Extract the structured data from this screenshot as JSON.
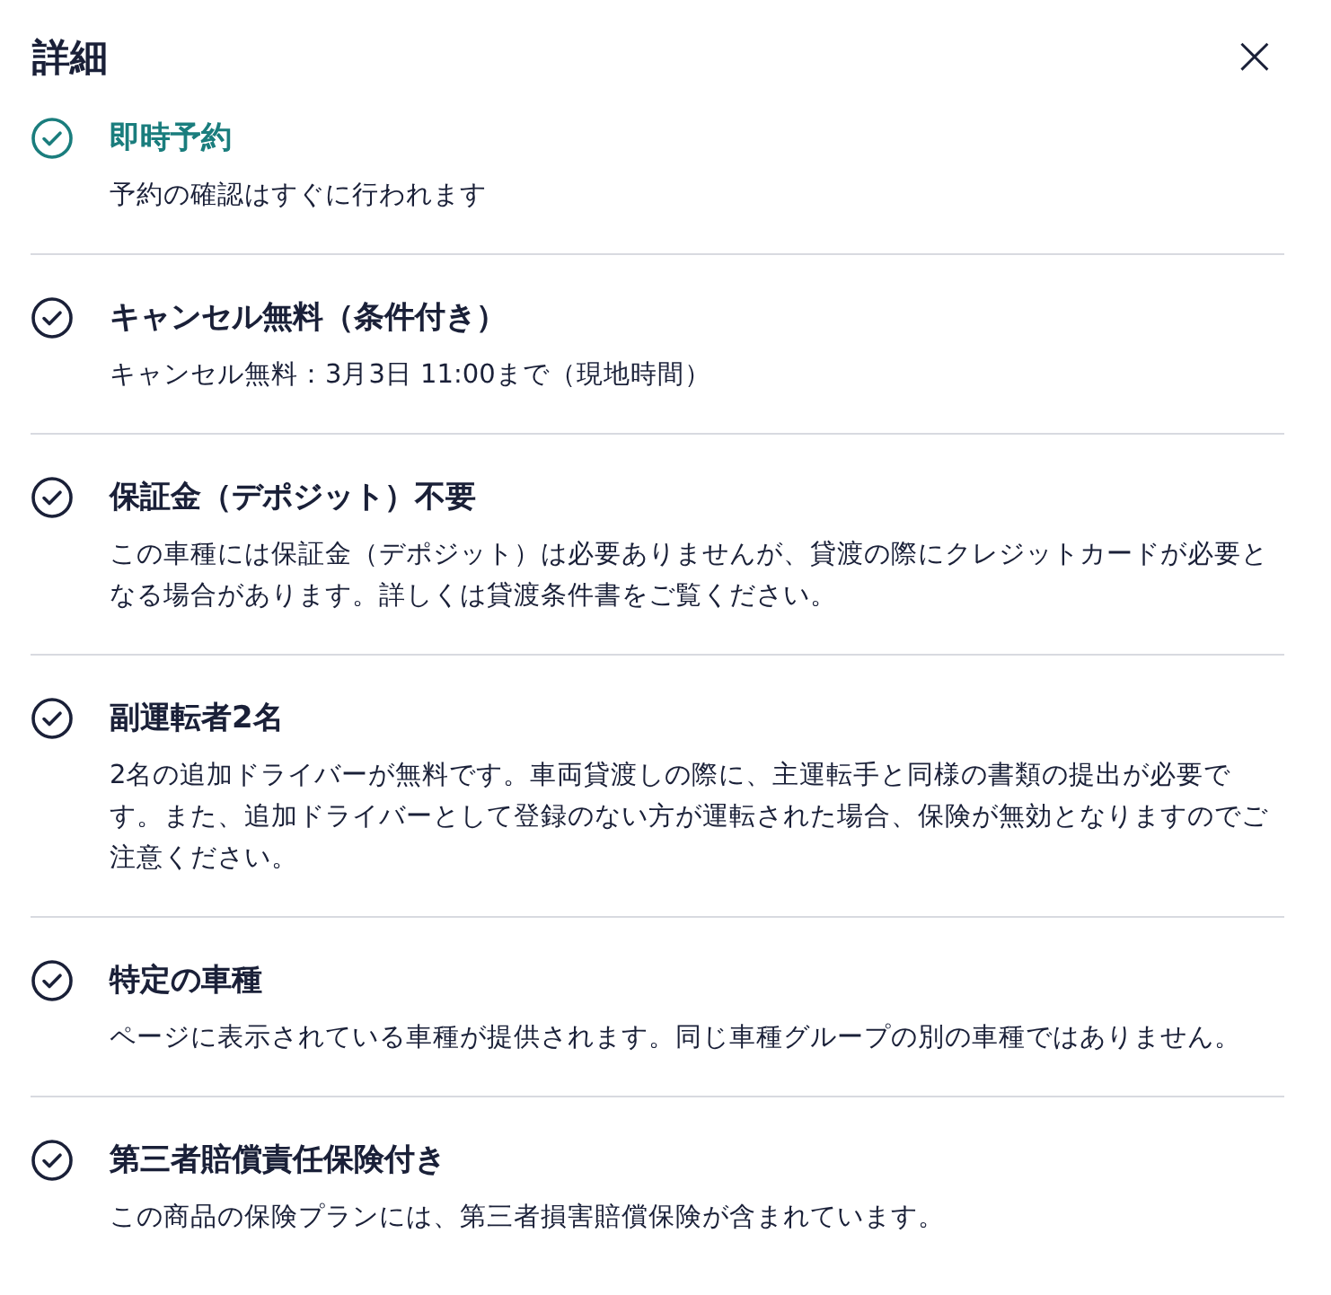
{
  "panel": {
    "title": "詳細",
    "close": "×"
  },
  "features": [
    {
      "title": "即時予約",
      "description": "予約の確認はすぐに行われます",
      "highlighted": true
    },
    {
      "title": "キャンセル無料（条件付き）",
      "description": "キャンセル無料：3月3日 11:00まで（現地時間）",
      "highlighted": false
    },
    {
      "title": "保証金（デポジット）不要",
      "description": "この車種には保証金（デポジット）は必要ありませんが、貸渡の際にクレジットカードが必要となる場合があります。詳しくは貸渡条件書をご覧ください。",
      "highlighted": false
    },
    {
      "title": "副運転者2名",
      "description": "2名の追加ドライバーが無料です。車両貸渡しの際に、主運転手と同様の書類の提出が必要です。また、追加ドライバーとして登録のない方が運転された場合、保険が無効となりますのでご注意ください。",
      "highlighted": false
    },
    {
      "title": "特定の車種",
      "description": "ページに表示されている車種が提供されます。同じ車種グループの別の車種ではありません。",
      "highlighted": false
    },
    {
      "title": "第三者賠償責任保険付き",
      "description": "この商品の保険プランには、第三者損害賠償保険が含まれています。",
      "highlighted": false
    }
  ]
}
